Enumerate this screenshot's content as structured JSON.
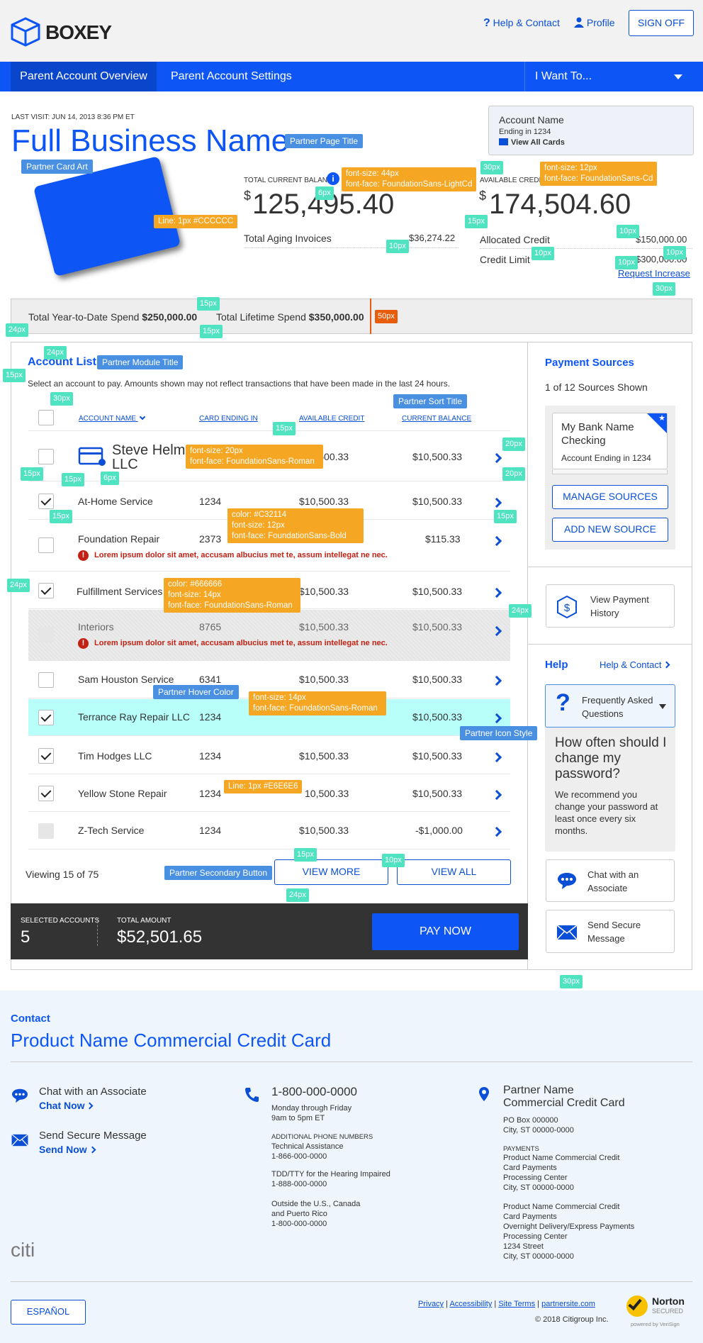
{
  "header": {
    "logo_text": "BOXEY",
    "help_label": "Help & Contact",
    "profile_label": "Profile",
    "signoff_label": "SIGN OFF"
  },
  "nav": {
    "items": [
      "Parent Account Overview",
      "Parent Account Settings"
    ],
    "menu_label": "I Want To..."
  },
  "summary": {
    "last_visit": "LAST VISIT: JUN 14, 2013 8:36 PM ET",
    "business_name": "Full Business Name",
    "account_box": {
      "name": "Account Name",
      "ending": "Ending in 1234",
      "view_cards": "View All Cards"
    },
    "balance_label": "TOTAL CURRENT BALANCE",
    "balance_value": "125,495.40",
    "aging_label": "Total Aging Invoices",
    "aging_value": "$36,274.22",
    "credit_label": "AVAILABLE CREDIT",
    "credit_value": "174,504.60",
    "allocated_label": "Allocated Credit",
    "allocated_value": "$150,000.00",
    "limit_label": "Credit Limit",
    "limit_value": "$300,000.00",
    "request_increase": "Request Increase",
    "currency": "$"
  },
  "spend": {
    "ytd_label": "Total Year-to-Date Spend",
    "ytd_value": "$250,000.00",
    "lifetime_label": "Total Lifetime Spend",
    "lifetime_value": "$350,000.00"
  },
  "accounts": {
    "title": "Account List",
    "intro": "Select an account to pay. Amounts shown may not reflect transactions that have been made in the last 24 hours.",
    "columns": [
      "ACCOUNT NAME",
      "CARD ENDING IN",
      "AVAILABLE CREDIT",
      "CURRENT BALANCE"
    ],
    "rows": [
      {
        "name": "Steve Helm LLC",
        "card": "",
        "credit": "$10,500.33",
        "balance": "$10,500.33"
      },
      {
        "name": "At-Home Service",
        "card": "1234",
        "credit": "$10,500.33",
        "balance": "$10,500.33"
      },
      {
        "name": "Foundation Repair",
        "card": "2373",
        "credit": "",
        "balance": "$115.33",
        "error": "Lorem ipsum dolor sit amet, accusam albucius met te, assum intellegat ne nec."
      },
      {
        "name": "Fulfillment Services",
        "card": "",
        "credit": "$10,500.33",
        "balance": "$10,500.33"
      },
      {
        "name": "Interiors",
        "card": "8765",
        "credit": "$10,500.33",
        "balance": "$10,500.33",
        "error": "Lorem ipsum dolor sit amet, accusam albucius met te, assum intellegat ne nec."
      },
      {
        "name": "Sam Houston Service",
        "card": "6341",
        "credit": "$10,500.33",
        "balance": "$10,500.33"
      },
      {
        "name": "Terrance Ray Repair LLC",
        "card": "1234",
        "credit": "",
        "balance": "$10,500.33"
      },
      {
        "name": "Tim Hodges LLC",
        "card": "1234",
        "credit": "$10,500.33",
        "balance": "$10,500.33"
      },
      {
        "name": "Yellow Stone Repair",
        "card": "1234",
        "credit": "10,500.33",
        "balance": "$10,500.33"
      },
      {
        "name": "Z-Tech Service",
        "card": "1234",
        "credit": "$10,500.33",
        "balance": "-$1,000.00"
      }
    ],
    "viewing": "Viewing 15 of 75",
    "view_more": "VIEW MORE",
    "view_all": "VIEW ALL"
  },
  "paybar": {
    "selected_label": "SELECTED ACCOUNTS",
    "selected_value": "5",
    "total_label": "TOTAL AMOUNT",
    "total_value": "$52,501.65",
    "pay_now": "PAY NOW"
  },
  "sidebar": {
    "payment_title": "Payment Sources",
    "sources_shown": "1 of 12 Sources Shown",
    "bank_name": "My Bank Name Checking",
    "bank_ending": "Account Ending in 1234",
    "manage": "MANAGE SOURCES",
    "add": "ADD NEW SOURCE",
    "history": "View Payment History",
    "help_title": "Help",
    "help_link": "Help & Contact",
    "faq_label": "Frequently Asked Questions",
    "faq_question": "How often should I change my password?",
    "faq_answer": "We recommend you change your password at least once every six months.",
    "chat": "Chat with an Associate",
    "secure": "Send Secure Message"
  },
  "annotations": {
    "partner_page_title": "Partner Page Title",
    "partner_card_art": "Partner Card Art",
    "font_44": "font-size: 44px\nfont-face: FoundationSans-LightCd",
    "font_12cd": "font-size: 12px\nfont-face: FoundationSans-Cd",
    "line_ccc": "Line: 1px #CCCCCC",
    "partner_module_title": "Partner Module Title",
    "partner_sort_title": "Partner Sort Title",
    "font_20": "font-size: 20px\nfont-face: FoundationSans-Roman",
    "font_c32114": "color: #C32114\nfont-size: 12px\nfont-face: FoundationSans-Bold",
    "font_666": "color: #666666\nfont-size: 14px\nfont-face: FoundationSans-Roman",
    "partner_hover": "Partner Hover Color",
    "font_14": "font-size: 14px\nfont-face: FoundationSans-Roman",
    "partner_icon": "Partner Icon Style",
    "line_e6": "Line: 1px #E6E6E6",
    "partner_secondary": "Partner Secondary Button",
    "px": [
      "30px",
      "6px",
      "15px",
      "10px",
      "10px",
      "10px",
      "10px",
      "10px",
      "30px",
      "15px",
      "15px",
      "24px",
      "24px",
      "15px",
      "30px",
      "15px",
      "20px",
      "20px",
      "15px",
      "15px",
      "6px",
      "15px",
      "15px",
      "24px",
      "24px",
      "15px",
      "10px",
      "24px",
      "30px",
      "50px"
    ]
  },
  "footer": {
    "contact_label": "Contact",
    "product_title": "Product Name Commercial Credit Card",
    "chat": "Chat with an Associate",
    "chat_now": "Chat Now",
    "secure": "Send Secure Message",
    "send_now": "Send Now",
    "phone": "1-800-000-0000",
    "hours": "Monday through Friday\n9am to 5pm ET",
    "addl_label": "ADDITIONAL PHONE NUMBERS",
    "tech": "Technical Assistance\n1-866-000-0000",
    "tdd": "TDD/TTY for the Hearing Impaired\n1-888-000-0000",
    "outside": "Outside the U.S., Canada\nand Puerto Rico\n1-800-000-0000",
    "partner": "Partner Name\nCommercial Credit Card",
    "po": "PO Box 000000\nCity, ST 00000-0000",
    "payments_label": "PAYMENTS",
    "payments": "Product Name Commercial Credit\nCard Payments\nProcessing Center\nCity, ST 00000-0000",
    "overnight": "Product Name Commercial Credit\nCard Payments\nOvernight Delivery/Express Payments\nProcessing Center\n1234 Street\nCity, ST 00000-0000",
    "citi": "citi",
    "espanol": "ESPAÑOL",
    "links": [
      "Privacy",
      "Accessibility",
      "Site Terms",
      "partnersite.com"
    ],
    "copyright": "© 2018 Citigroup Inc.",
    "norton": "Norton",
    "secured": "SECURED",
    "verisign": "powered by VeriSign"
  }
}
